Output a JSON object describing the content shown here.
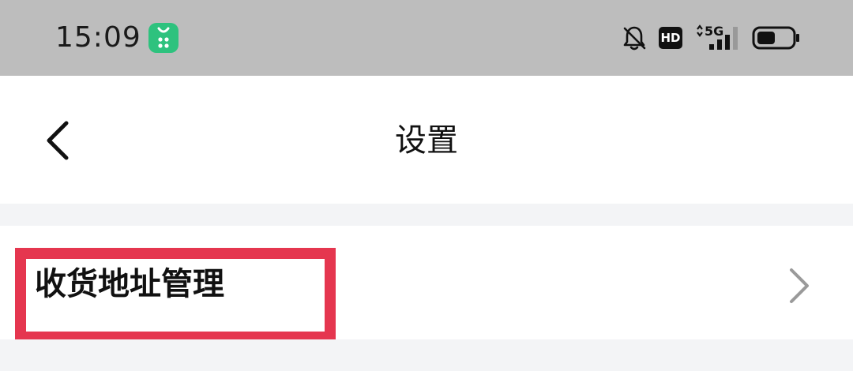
{
  "status_bar": {
    "time": "15:09",
    "icons": [
      "app-icon",
      "bell-off-icon",
      "hd-icon",
      "5g-signal-icon",
      "battery-icon"
    ],
    "hd_label": "HD",
    "network_label": "5G"
  },
  "header": {
    "title": "设置",
    "back_icon": "chevron-left-icon"
  },
  "settings": {
    "items": [
      {
        "label": "收货地址管理",
        "icon": "chevron-right-icon"
      }
    ]
  },
  "colors": {
    "status_bar_bg": "#bdbdbd",
    "highlight": "#e5364f",
    "app_icon": "#2ec27e",
    "divider": "#f3f4f6"
  }
}
